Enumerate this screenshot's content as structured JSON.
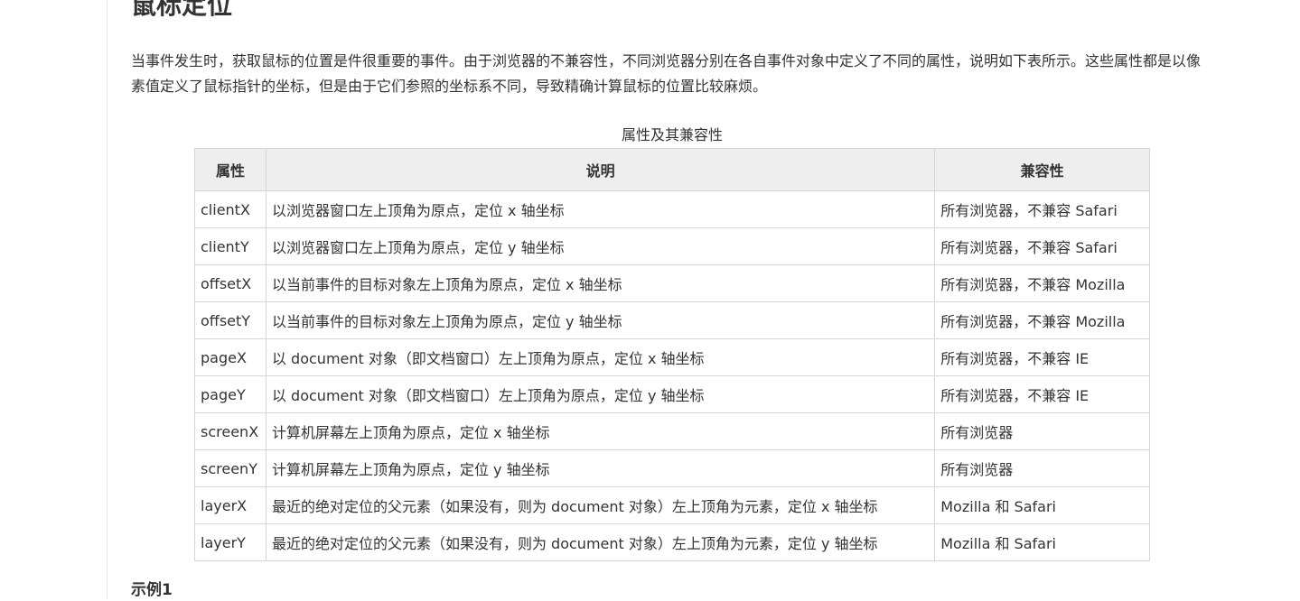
{
  "section": {
    "title": "鼠标定位",
    "intro": "当事件发生时，获取鼠标的位置是件很重要的事件。由于浏览器的不兼容性，不同浏览器分别在各自事件对象中定义了不同的属性，说明如下表所示。这些属性都是以像素值定义了鼠标指针的坐标，但是由于它们参照的坐标系不同，导致精确计算鼠标的位置比较麻烦。"
  },
  "table": {
    "caption": "属性及其兼容性",
    "headers": [
      "属性",
      "说明",
      "兼容性"
    ],
    "rows": [
      {
        "prop": "clientX",
        "desc": "以浏览器窗口左上顶角为原点，定位 x 轴坐标",
        "compat": "所有浏览器，不兼容 Safari"
      },
      {
        "prop": "clientY",
        "desc": "以浏览器窗口左上顶角为原点，定位 y 轴坐标",
        "compat": "所有浏览器，不兼容 Safari"
      },
      {
        "prop": "offsetX",
        "desc": "以当前事件的目标对象左上顶角为原点，定位 x 轴坐标",
        "compat": "所有浏览器，不兼容 Mozilla"
      },
      {
        "prop": "offsetY",
        "desc": "以当前事件的目标对象左上顶角为原点，定位 y 轴坐标",
        "compat": "所有浏览器，不兼容 Mozilla"
      },
      {
        "prop": "pageX",
        "desc": "以 document 对象（即文档窗口）左上顶角为原点，定位 x 轴坐标",
        "compat": "所有浏览器，不兼容 IE"
      },
      {
        "prop": "pageY",
        "desc": "以 document 对象（即文档窗口）左上顶角为原点，定位 y 轴坐标",
        "compat": "所有浏览器，不兼容 IE"
      },
      {
        "prop": "screenX",
        "desc": "计算机屏幕左上顶角为原点，定位 x 轴坐标",
        "compat": "所有浏览器"
      },
      {
        "prop": "screenY",
        "desc": "计算机屏幕左上顶角为原点，定位 y 轴坐标",
        "compat": "所有浏览器"
      },
      {
        "prop": "layerX",
        "desc": "最近的绝对定位的父元素（如果没有，则为 document 对象）左上顶角为元素，定位 x 轴坐标",
        "compat": "Mozilla 和 Safari"
      },
      {
        "prop": "layerY",
        "desc": "最近的绝对定位的父元素（如果没有，则为 document 对象）左上顶角为元素，定位 y 轴坐标",
        "compat": "Mozilla 和 Safari"
      }
    ]
  },
  "example": {
    "title": "示例1"
  }
}
